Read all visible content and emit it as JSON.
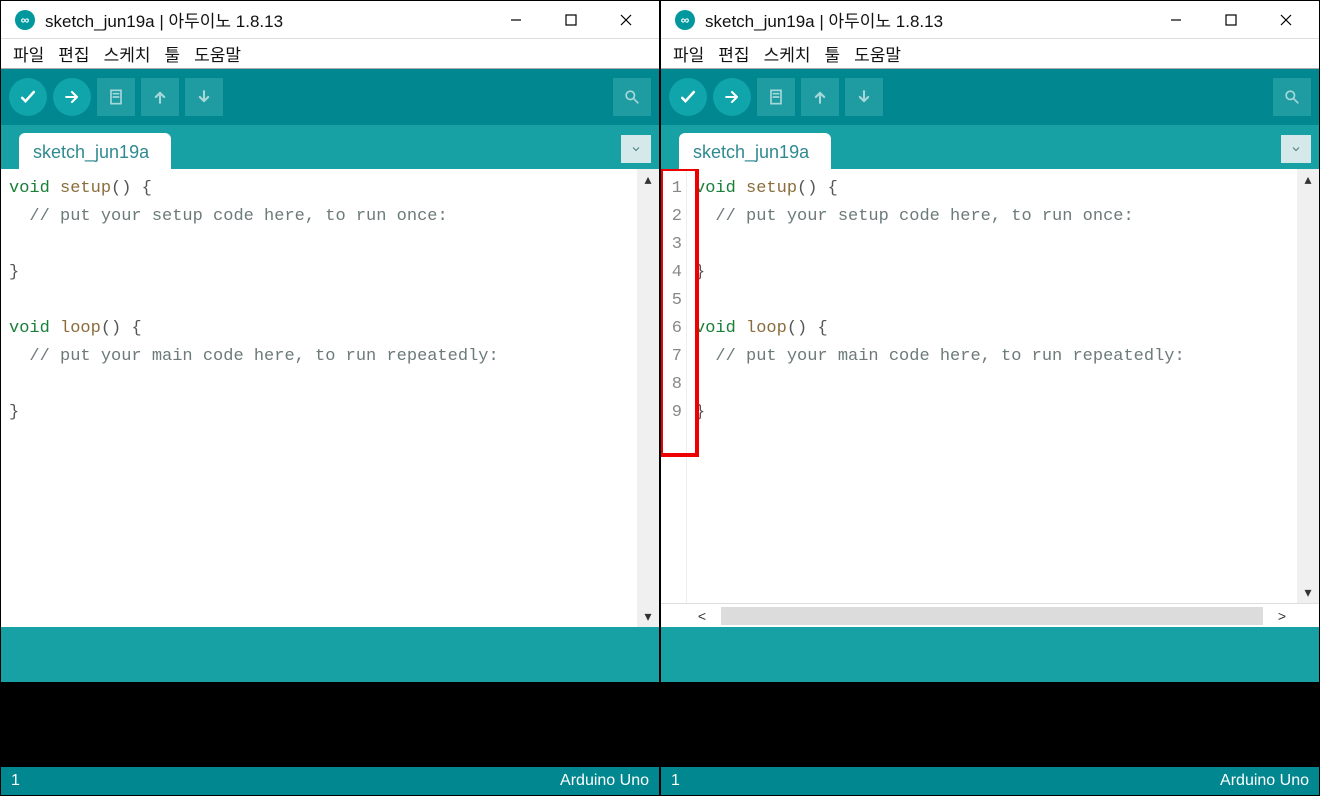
{
  "windows": [
    {
      "title": "sketch_jun19a | 아두이노 1.8.13",
      "menu": [
        "파일",
        "편집",
        "스케치",
        "툴",
        "도움말"
      ],
      "tab": "sketch_jun19a",
      "show_line_numbers": false,
      "show_hscroll": false,
      "highlight_gutter": false,
      "code_lines": [
        {
          "tokens": [
            {
              "t": "kw",
              "s": "void"
            },
            {
              "t": "sp",
              "s": " "
            },
            {
              "t": "fn",
              "s": "setup"
            },
            {
              "t": "paren",
              "s": "()"
            },
            {
              "t": "sp",
              "s": " "
            },
            {
              "t": "brace",
              "s": "{"
            }
          ]
        },
        {
          "tokens": [
            {
              "t": "sp",
              "s": "  "
            },
            {
              "t": "cmt",
              "s": "// put your setup code here, to run once:"
            }
          ]
        },
        {
          "tokens": []
        },
        {
          "tokens": [
            {
              "t": "brace",
              "s": "}"
            }
          ]
        },
        {
          "tokens": []
        },
        {
          "tokens": [
            {
              "t": "kw",
              "s": "void"
            },
            {
              "t": "sp",
              "s": " "
            },
            {
              "t": "fn",
              "s": "loop"
            },
            {
              "t": "paren",
              "s": "()"
            },
            {
              "t": "sp",
              "s": " "
            },
            {
              "t": "brace",
              "s": "{"
            }
          ]
        },
        {
          "tokens": [
            {
              "t": "sp",
              "s": "  "
            },
            {
              "t": "cmt",
              "s": "// put your main code here, to run repeatedly:"
            }
          ]
        },
        {
          "tokens": []
        },
        {
          "tokens": [
            {
              "t": "brace",
              "s": "}"
            }
          ]
        }
      ],
      "status_left": "1",
      "status_right": "Arduino Uno"
    },
    {
      "title": "sketch_jun19a | 아두이노 1.8.13",
      "menu": [
        "파일",
        "편집",
        "스케치",
        "툴",
        "도움말"
      ],
      "tab": "sketch_jun19a",
      "show_line_numbers": true,
      "show_hscroll": true,
      "highlight_gutter": true,
      "code_lines": [
        {
          "n": "1",
          "tokens": [
            {
              "t": "kw",
              "s": "void"
            },
            {
              "t": "sp",
              "s": " "
            },
            {
              "t": "fn",
              "s": "setup"
            },
            {
              "t": "paren",
              "s": "()"
            },
            {
              "t": "sp",
              "s": " "
            },
            {
              "t": "brace",
              "s": "{"
            }
          ]
        },
        {
          "n": "2",
          "tokens": [
            {
              "t": "sp",
              "s": "  "
            },
            {
              "t": "cmt",
              "s": "// put your setup code here, to run once:"
            }
          ]
        },
        {
          "n": "3",
          "tokens": []
        },
        {
          "n": "4",
          "tokens": [
            {
              "t": "brace",
              "s": "}"
            }
          ]
        },
        {
          "n": "5",
          "tokens": []
        },
        {
          "n": "6",
          "tokens": [
            {
              "t": "kw",
              "s": "void"
            },
            {
              "t": "sp",
              "s": " "
            },
            {
              "t": "fn",
              "s": "loop"
            },
            {
              "t": "paren",
              "s": "()"
            },
            {
              "t": "sp",
              "s": " "
            },
            {
              "t": "brace",
              "s": "{"
            }
          ]
        },
        {
          "n": "7",
          "tokens": [
            {
              "t": "sp",
              "s": "  "
            },
            {
              "t": "cmt",
              "s": "// put your main code here, to run repeatedly:"
            }
          ]
        },
        {
          "n": "8",
          "tokens": []
        },
        {
          "n": "9",
          "tokens": [
            {
              "t": "brace",
              "s": "}"
            }
          ]
        }
      ],
      "status_left": "1",
      "status_right": "Arduino Uno"
    }
  ],
  "icons": {
    "verify": "check",
    "upload": "arrow-right",
    "new": "file",
    "open": "arrow-up",
    "save": "arrow-down",
    "serial": "magnify"
  }
}
